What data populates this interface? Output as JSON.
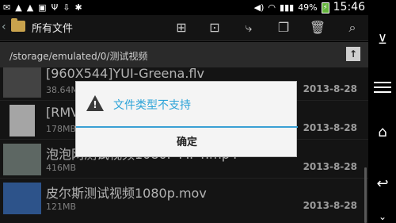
{
  "statusbar": {
    "left_icons": [
      "email-icon",
      "warning-icon",
      "warning-icon",
      "image-icon",
      "usb-icon",
      "download-icon",
      "android-icon"
    ],
    "battery_percent": "49%",
    "time": "15:46"
  },
  "actionbar": {
    "title": "所有文件"
  },
  "pathbar": {
    "path": "/storage/emulated/0/测试视频"
  },
  "files": [
    {
      "name": "[960X544]YUI-Greena.flv",
      "size": "38.64MB",
      "date": "2013-8-28"
    },
    {
      "name": "[RMV",
      "size": "178MB",
      "date": "2013-8-28"
    },
    {
      "name": "泡泡网测试视频1080P MP4.mp4",
      "size": "416MB",
      "date": "2013-8-28"
    },
    {
      "name": "皮尔斯测试视频1080p.mov",
      "size": "121MB",
      "date": "2013-8-28"
    }
  ],
  "dialog": {
    "title": "文件类型不支持",
    "ok_label": "确定"
  },
  "colors": {
    "accent": "#2ba3d8",
    "dialog_bg": "#f4f4f4",
    "list_bg": "#1b1b1b"
  }
}
